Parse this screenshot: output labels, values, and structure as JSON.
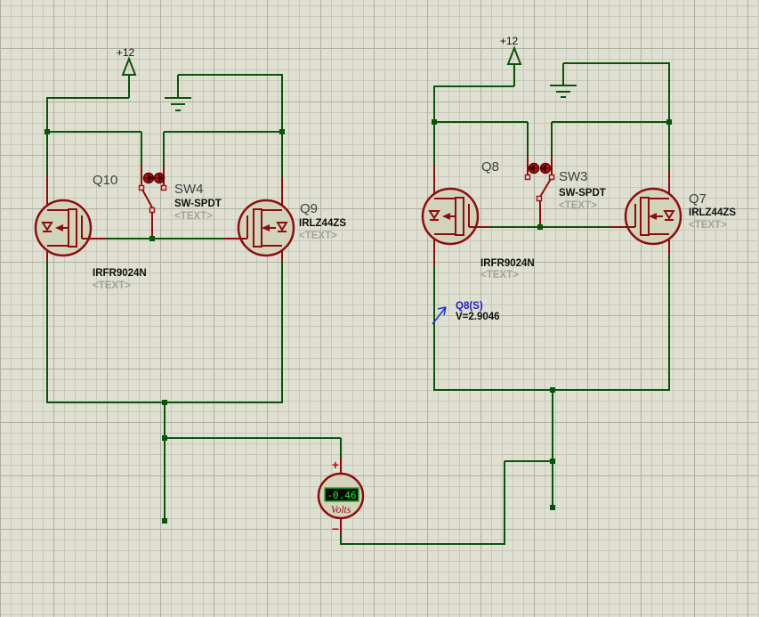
{
  "power": {
    "left_label": "+12",
    "right_label": "+12"
  },
  "components": {
    "q10": {
      "ref": "Q10",
      "value": "IRFR9024N",
      "placeholder": "<TEXT>"
    },
    "sw4": {
      "ref": "SW4",
      "value": "SW-SPDT",
      "placeholder": "<TEXT>"
    },
    "q9": {
      "ref": "Q9",
      "value": "IRLZ44ZS",
      "placeholder": "<TEXT>"
    },
    "q8": {
      "ref": "Q8",
      "value": "IRFR9024N",
      "placeholder": "<TEXT>"
    },
    "sw3": {
      "ref": "SW3",
      "value": "SW-SPDT",
      "placeholder": "<TEXT>"
    },
    "q7": {
      "ref": "Q7",
      "value": "IRLZ44ZS",
      "placeholder": "<TEXT>"
    }
  },
  "probe": {
    "label": "Q8(S)",
    "value": "V=2.9046"
  },
  "voltmeter": {
    "reading": "-0.46",
    "unit": "Volts",
    "plus_label": "+",
    "minus_label": "−"
  },
  "colors": {
    "background": "#e0e0d2",
    "wire_green": "#0a540a",
    "component_red": "#8a0e0e",
    "toggle_red": "#cc0f0f",
    "display_bg": "#070707",
    "display_text": "#2de82d",
    "probe_blue": "#1d1dbb"
  }
}
